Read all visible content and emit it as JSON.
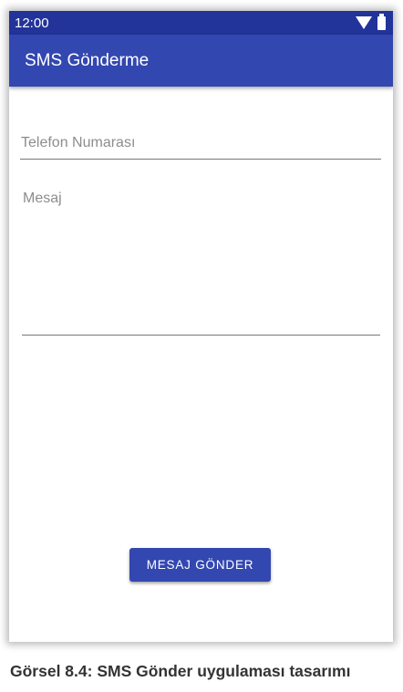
{
  "status_bar": {
    "time": "12:00",
    "icons": [
      "wifi-icon",
      "battery-icon"
    ]
  },
  "app_bar": {
    "title": "SMS Gönderme"
  },
  "form": {
    "phone_placeholder": "Telefon Numarası",
    "phone_value": "",
    "message_placeholder": "Mesaj",
    "message_value": "",
    "send_label": "MESAJ GÖNDER"
  },
  "caption": "Görsel 8.4: SMS Gönder uygulaması tasarımı",
  "colors": {
    "status_bar": "#223399",
    "primary": "#3347b0",
    "hint_text": "#8d8d8d"
  }
}
